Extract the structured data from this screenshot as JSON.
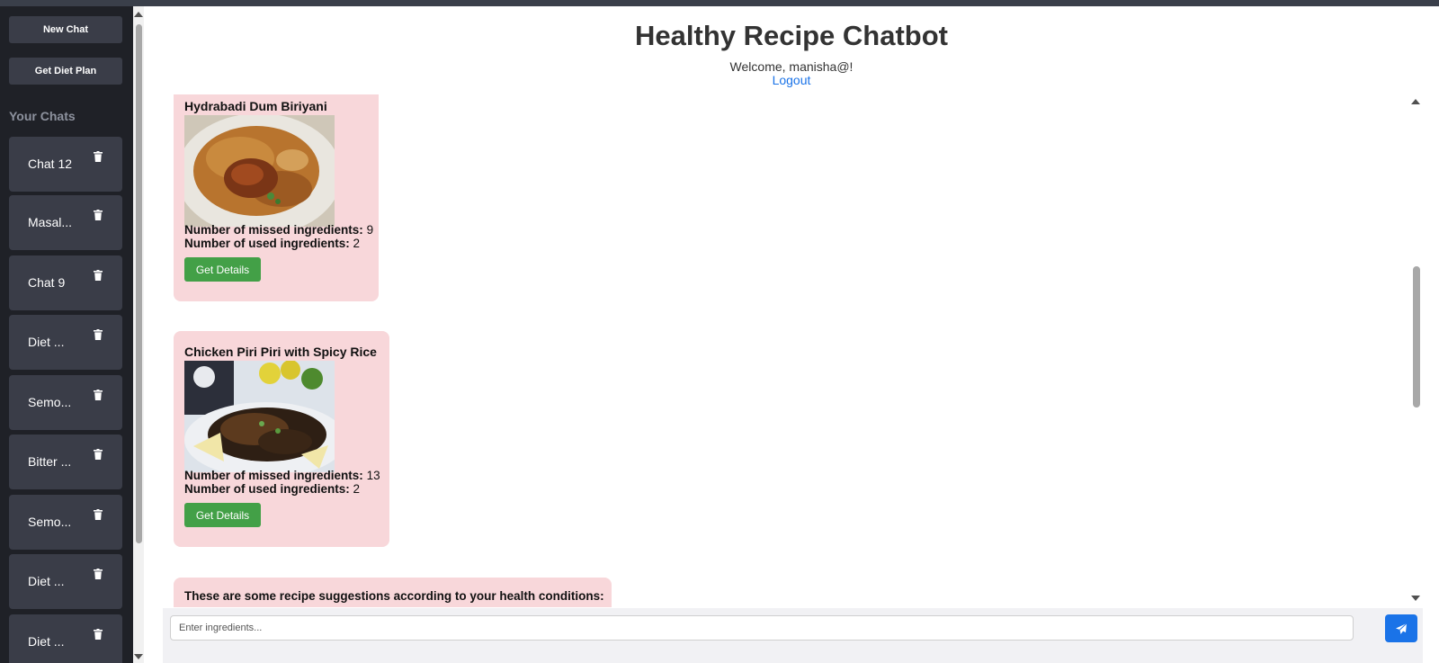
{
  "app": {
    "title": "Healthy Recipe Chatbot"
  },
  "header": {
    "welcome": "Welcome, manisha@!",
    "logout": "Logout"
  },
  "sidebar": {
    "new_chat": "New Chat",
    "diet_plan": "Get Diet Plan",
    "heading": "Your Chats",
    "chats": [
      {
        "label": "Chat 12"
      },
      {
        "label": "Masal..."
      },
      {
        "label": "Chat 9"
      },
      {
        "label": "Diet ..."
      },
      {
        "label": "Semo..."
      },
      {
        "label": "Bitter ..."
      },
      {
        "label": "Semo..."
      },
      {
        "label": "Diet ..."
      },
      {
        "label": "Diet ..."
      }
    ],
    "delete_icon": "trash-icon"
  },
  "messages": {
    "recipes": [
      {
        "title": "Hydrabadi Dum Biriyani",
        "missed_label": "Number of missed ingredients:",
        "missed_value": "9",
        "used_label": "Number of used ingredients:",
        "used_value": "2",
        "button": "Get Details"
      },
      {
        "title": "Chicken Piri Piri with Spicy Rice",
        "missed_label": "Number of missed ingredients:",
        "missed_value": "13",
        "used_label": "Number of used ingredients:",
        "used_value": "2",
        "button": "Get Details"
      }
    ],
    "suggestion": "These are some recipe suggestions according to your health conditions:"
  },
  "input": {
    "placeholder": "Enter ingredients...",
    "send_icon": "paper-plane-icon"
  },
  "colors": {
    "sidebar_bg": "#1f2127",
    "sidebar_item": "#3a3d48",
    "card_bg": "#f8d7da",
    "details_button": "#43a047",
    "accent": "#1a73e8"
  }
}
